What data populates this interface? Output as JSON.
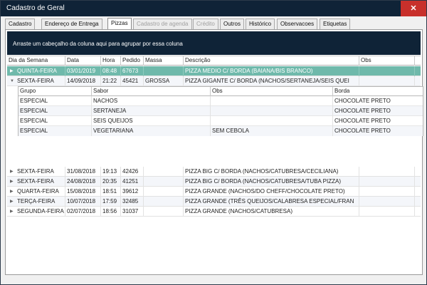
{
  "window": {
    "title": "Cadastro de Geral",
    "close_label": "✕"
  },
  "tabs": [
    {
      "label": "Cadastro",
      "state": "normal"
    },
    {
      "label": "Endereço de Entrega",
      "state": "normal"
    },
    {
      "label": "Pizzas",
      "state": "active"
    },
    {
      "label": "Cadastro de agenda",
      "state": "disabled"
    },
    {
      "label": "Crédito",
      "state": "disabled"
    },
    {
      "label": "Outros",
      "state": "normal"
    },
    {
      "label": "Histórico",
      "state": "normal"
    },
    {
      "label": "Observacoes",
      "state": "normal"
    },
    {
      "label": "Etiquetas",
      "state": "normal"
    }
  ],
  "groupbar": {
    "text": "Arraste um cabeçalho da coluna aqui para agrupar por essa coluna"
  },
  "grid": {
    "columns": [
      "Dia da Semana",
      "Data",
      "Hora",
      "Pedido",
      "Massa",
      "Descrição",
      "Obs"
    ],
    "rows": [
      {
        "dia": "QUINTA-FEIRA",
        "data": "03/01/2019",
        "hora": "08:48",
        "pedido": "67673",
        "massa": "",
        "descricao": "PIZZA MEDIO C/ BORDA (BAIANA/BIS BRANCO)",
        "obs": "",
        "selected": true,
        "expanded": false
      },
      {
        "dia": "SEXTA-FEIRA",
        "data": "14/09/2018",
        "hora": "21:22",
        "pedido": "45421",
        "massa": "GROSSA",
        "descricao": "PIZZA GIGANTE C/ BORDA (NACHOS/SERTANEJA/SEIS QUEI",
        "obs": "",
        "selected": false,
        "expanded": true
      },
      {
        "dia": "SEXTA-FEIRA",
        "data": "31/08/2018",
        "hora": "19:13",
        "pedido": "42426",
        "massa": "",
        "descricao": "PIZZA BIG C/ BORDA (NACHOS/CATUBRESA/CECILIANA)",
        "obs": "",
        "selected": false,
        "expanded": false
      },
      {
        "dia": "SEXTA-FEIRA",
        "data": "24/08/2018",
        "hora": "20:35",
        "pedido": "41251",
        "massa": "",
        "descricao": "PIZZA BIG C/ BORDA (NACHOS/CATUBRESA/TUBA PIZZA)",
        "obs": "",
        "selected": false,
        "expanded": false
      },
      {
        "dia": "QUARTA-FEIRA",
        "data": "15/08/2018",
        "hora": "18:51",
        "pedido": "39612",
        "massa": "",
        "descricao": "PIZZA GRANDE (NACHOS/DO CHEFF/CHOCOLATE PRETO)",
        "obs": "",
        "selected": false,
        "expanded": false
      },
      {
        "dia": "TERÇA-FEIRA",
        "data": "10/07/2018",
        "hora": "17:59",
        "pedido": "32485",
        "massa": "",
        "descricao": "PIZZA GRANDE (TRÊS QUEIJOS/CALABRESA ESPECIAL/FRAN",
        "obs": "",
        "selected": false,
        "expanded": false
      },
      {
        "dia": "SEGUNDA-FEIRA",
        "data": "02/07/2018",
        "hora": "18:56",
        "pedido": "31037",
        "massa": "",
        "descricao": "PIZZA GRANDE (NACHOS/CATUBRESA)",
        "obs": "",
        "selected": false,
        "expanded": false
      }
    ],
    "detail": {
      "columns": [
        "Grupo",
        "Sabor",
        "Obs",
        "Borda"
      ],
      "rows": [
        {
          "grupo": "ESPECIAL",
          "sabor": "NACHOS",
          "obs": "",
          "borda": "CHOCOLATE PRETO"
        },
        {
          "grupo": "ESPECIAL",
          "sabor": "SERTANEJA",
          "obs": "",
          "borda": "CHOCOLATE PRETO"
        },
        {
          "grupo": "ESPECIAL",
          "sabor": "SEIS QUEIJOS",
          "obs": "",
          "borda": "CHOCOLATE PRETO"
        },
        {
          "grupo": "ESPECIAL",
          "sabor": "VEGETARIANA",
          "obs": "SEM CEBOLA",
          "borda": "CHOCOLATE PRETO"
        }
      ]
    }
  },
  "colors": {
    "titlebar": "#0f2337",
    "close": "#c8302b",
    "selected_row": "#6fb9ab",
    "groupbar": "#0f2337"
  },
  "icons": {
    "expand": "chevron-right-icon",
    "collapse": "chevron-down-icon"
  }
}
